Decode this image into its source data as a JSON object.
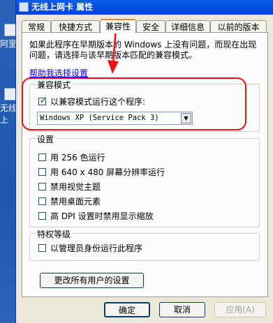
{
  "desktop": {
    "items": [
      {
        "label": "阿里"
      },
      {
        "label": "无线上"
      }
    ]
  },
  "window": {
    "title": "无线上网卡 属性"
  },
  "tabs": [
    {
      "label": "常规"
    },
    {
      "label": "快捷方式"
    },
    {
      "label": "兼容性",
      "active": true
    },
    {
      "label": "安全"
    },
    {
      "label": "详细信息"
    },
    {
      "label": "以前的版本"
    }
  ],
  "page": {
    "description": "如果此程序在早期版本的 Windows 上没有问题，而现在出现问题，请选择与该早期版本匹配的兼容模式。",
    "help_link": "帮助我选择设置",
    "compat_group": {
      "title": "兼容模式",
      "checkbox_label": "以兼容模式运行这个程序:",
      "checked": true,
      "selected_os": "Windows XP (Service Pack 3)"
    },
    "settings_group": {
      "title": "设置",
      "options": [
        {
          "label": "用 256 色运行",
          "checked": false
        },
        {
          "label": "用 640 x 480 屏幕分辨率运行",
          "checked": false
        },
        {
          "label": "禁用视觉主题",
          "checked": false
        },
        {
          "label": "禁用桌面元素",
          "checked": false
        },
        {
          "label": "高 DPI 设置时禁用显示缩放",
          "checked": false
        }
      ]
    },
    "privilege_group": {
      "title": "特权等级",
      "checkbox_label": "以管理员身份运行此程序",
      "checked": false
    },
    "all_users_button": "更改所有用户的设置"
  },
  "buttons": {
    "ok": "确定",
    "cancel": "取消",
    "apply": "应用(A)"
  },
  "colors": {
    "annotation": "#ee1111",
    "link": "#0000ee",
    "titlebar": "#0050e0"
  }
}
